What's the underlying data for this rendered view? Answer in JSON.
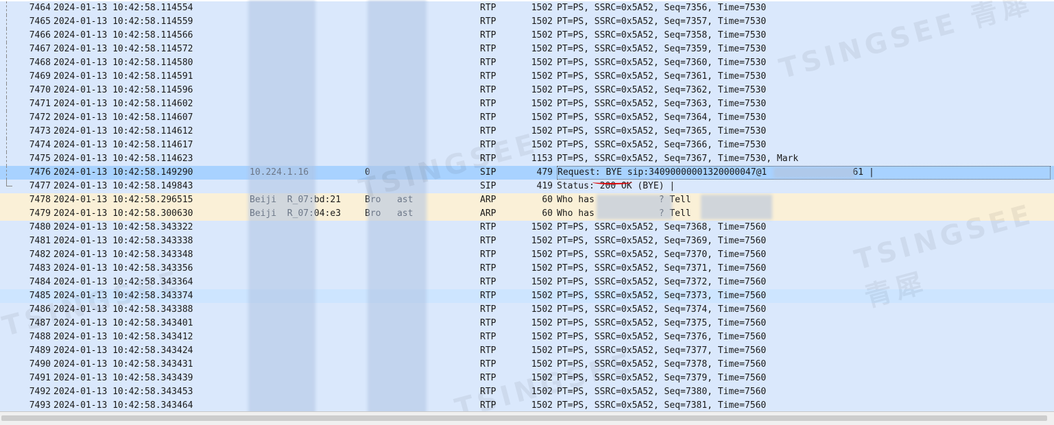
{
  "watermarks": [
    "TSINGSEE 青犀",
    "TSINGSEE",
    "TSINGSEE 青犀",
    "TSINGSEE",
    "TSINGSEE"
  ],
  "colors": {
    "rtp_row": "#dae8fc",
    "arp_row": "#faf0d7",
    "selected_row": "#a8d2ff",
    "annotation": "#dd0000"
  },
  "packets": [
    {
      "no": "7464",
      "time": "2024-01-13 10:42:58.114554",
      "src": "",
      "dst": "",
      "proto": "RTP",
      "len": "1502",
      "info": "PT=PS, SSRC=0x5A52, Seq=7356, Time=7530",
      "kind": "rtp"
    },
    {
      "no": "7465",
      "time": "2024-01-13 10:42:58.114559",
      "src": "",
      "dst": "",
      "proto": "RTP",
      "len": "1502",
      "info": "PT=PS, SSRC=0x5A52, Seq=7357, Time=7530",
      "kind": "rtp"
    },
    {
      "no": "7466",
      "time": "2024-01-13 10:42:58.114566",
      "src": "",
      "dst": "",
      "proto": "RTP",
      "len": "1502",
      "info": "PT=PS, SSRC=0x5A52, Seq=7358, Time=7530",
      "kind": "rtp"
    },
    {
      "no": "7467",
      "time": "2024-01-13 10:42:58.114572",
      "src": "",
      "dst": "",
      "proto": "RTP",
      "len": "1502",
      "info": "PT=PS, SSRC=0x5A52, Seq=7359, Time=7530",
      "kind": "rtp"
    },
    {
      "no": "7468",
      "time": "2024-01-13 10:42:58.114580",
      "src": "",
      "dst": "",
      "proto": "RTP",
      "len": "1502",
      "info": "PT=PS, SSRC=0x5A52, Seq=7360, Time=7530",
      "kind": "rtp"
    },
    {
      "no": "7469",
      "time": "2024-01-13 10:42:58.114591",
      "src": "",
      "dst": "",
      "proto": "RTP",
      "len": "1502",
      "info": "PT=PS, SSRC=0x5A52, Seq=7361, Time=7530",
      "kind": "rtp"
    },
    {
      "no": "7470",
      "time": "2024-01-13 10:42:58.114596",
      "src": "",
      "dst": "",
      "proto": "RTP",
      "len": "1502",
      "info": "PT=PS, SSRC=0x5A52, Seq=7362, Time=7530",
      "kind": "rtp"
    },
    {
      "no": "7471",
      "time": "2024-01-13 10:42:58.114602",
      "src": "",
      "dst": "",
      "proto": "RTP",
      "len": "1502",
      "info": "PT=PS, SSRC=0x5A52, Seq=7363, Time=7530",
      "kind": "rtp"
    },
    {
      "no": "7472",
      "time": "2024-01-13 10:42:58.114607",
      "src": "",
      "dst": "",
      "proto": "RTP",
      "len": "1502",
      "info": "PT=PS, SSRC=0x5A52, Seq=7364, Time=7530",
      "kind": "rtp"
    },
    {
      "no": "7473",
      "time": "2024-01-13 10:42:58.114612",
      "src": "",
      "dst": "",
      "proto": "RTP",
      "len": "1502",
      "info": "PT=PS, SSRC=0x5A52, Seq=7365, Time=7530",
      "kind": "rtp"
    },
    {
      "no": "7474",
      "time": "2024-01-13 10:42:58.114617",
      "src": "",
      "dst": "",
      "proto": "RTP",
      "len": "1502",
      "info": "PT=PS, SSRC=0x5A52, Seq=7366, Time=7530",
      "kind": "rtp"
    },
    {
      "no": "7475",
      "time": "2024-01-13 10:42:58.114623",
      "src": "",
      "dst": "",
      "proto": "RTP",
      "len": "1153",
      "info": "PT=PS, SSRC=0x5A52, Seq=7367, Time=7530, Mark",
      "kind": "rtp"
    },
    {
      "no": "7476",
      "time": "2024-01-13 10:42:58.149290",
      "src": "10.224.1.16",
      "dst": "0",
      "proto": "SIP",
      "len": "479",
      "info": "Request: BYE sip:34090000001320000047@1                61 |",
      "kind": "selected"
    },
    {
      "no": "7477",
      "time": "2024-01-13 10:42:58.149843",
      "src": "",
      "dst": "",
      "proto": "SIP",
      "len": "419",
      "info": "Status: 200 OK (BYE) |",
      "kind": "sip"
    },
    {
      "no": "7478",
      "time": "2024-01-13 10:42:58.296515",
      "src": "Beiji  R_07:bd:21",
      "dst": "Bro   ast",
      "proto": "ARP",
      "len": "60",
      "info": "Who has            ? Tell",
      "kind": "arp"
    },
    {
      "no": "7479",
      "time": "2024-01-13 10:42:58.300630",
      "src": "Beiji  R_07:04:e3",
      "dst": "Bro   ast",
      "proto": "ARP",
      "len": "60",
      "info": "Who has            ? Tell",
      "kind": "arp"
    },
    {
      "no": "7480",
      "time": "2024-01-13 10:42:58.343322",
      "src": "",
      "dst": "",
      "proto": "RTP",
      "len": "1502",
      "info": "PT=PS, SSRC=0x5A52, Seq=7368, Time=7560",
      "kind": "rtp"
    },
    {
      "no": "7481",
      "time": "2024-01-13 10:42:58.343338",
      "src": "",
      "dst": "",
      "proto": "RTP",
      "len": "1502",
      "info": "PT=PS, SSRC=0x5A52, Seq=7369, Time=7560",
      "kind": "rtp"
    },
    {
      "no": "7482",
      "time": "2024-01-13 10:42:58.343348",
      "src": "",
      "dst": "",
      "proto": "RTP",
      "len": "1502",
      "info": "PT=PS, SSRC=0x5A52, Seq=7370, Time=7560",
      "kind": "rtp"
    },
    {
      "no": "7483",
      "time": "2024-01-13 10:42:58.343356",
      "src": "",
      "dst": "",
      "proto": "RTP",
      "len": "1502",
      "info": "PT=PS, SSRC=0x5A52, Seq=7371, Time=7560",
      "kind": "rtp"
    },
    {
      "no": "7484",
      "time": "2024-01-13 10:42:58.343364",
      "src": "",
      "dst": "",
      "proto": "RTP",
      "len": "1502",
      "info": "PT=PS, SSRC=0x5A52, Seq=7372, Time=7560",
      "kind": "rtp"
    },
    {
      "no": "7485",
      "time": "2024-01-13 10:42:58.343374",
      "src": "",
      "dst": "",
      "proto": "RTP",
      "len": "1502",
      "info": "PT=PS, SSRC=0x5A52, Seq=7373, Time=7560",
      "kind": "selected-alt"
    },
    {
      "no": "7486",
      "time": "2024-01-13 10:42:58.343388",
      "src": "",
      "dst": "",
      "proto": "RTP",
      "len": "1502",
      "info": "PT=PS, SSRC=0x5A52, Seq=7374, Time=7560",
      "kind": "rtp"
    },
    {
      "no": "7487",
      "time": "2024-01-13 10:42:58.343401",
      "src": "",
      "dst": "",
      "proto": "RTP",
      "len": "1502",
      "info": "PT=PS, SSRC=0x5A52, Seq=7375, Time=7560",
      "kind": "rtp"
    },
    {
      "no": "7488",
      "time": "2024-01-13 10:42:58.343412",
      "src": "",
      "dst": "",
      "proto": "RTP",
      "len": "1502",
      "info": "PT=PS, SSRC=0x5A52, Seq=7376, Time=7560",
      "kind": "rtp"
    },
    {
      "no": "7489",
      "time": "2024-01-13 10:42:58.343424",
      "src": "",
      "dst": "",
      "proto": "RTP",
      "len": "1502",
      "info": "PT=PS, SSRC=0x5A52, Seq=7377, Time=7560",
      "kind": "rtp"
    },
    {
      "no": "7490",
      "time": "2024-01-13 10:42:58.343431",
      "src": "",
      "dst": "",
      "proto": "RTP",
      "len": "1502",
      "info": "PT=PS, SSRC=0x5A52, Seq=7378, Time=7560",
      "kind": "rtp"
    },
    {
      "no": "7491",
      "time": "2024-01-13 10:42:58.343439",
      "src": "",
      "dst": "",
      "proto": "RTP",
      "len": "1502",
      "info": "PT=PS, SSRC=0x5A52, Seq=7379, Time=7560",
      "kind": "rtp"
    },
    {
      "no": "7492",
      "time": "2024-01-13 10:42:58.343453",
      "src": "",
      "dst": "",
      "proto": "RTP",
      "len": "1502",
      "info": "PT=PS, SSRC=0x5A52, Seq=7380, Time=7560",
      "kind": "rtp"
    },
    {
      "no": "7493",
      "time": "2024-01-13 10:42:58.343464",
      "src": "",
      "dst": "",
      "proto": "RTP",
      "len": "1502",
      "info": "PT=PS, SSRC=0x5A52, Seq=7381, Time=7560",
      "kind": "rtp"
    }
  ]
}
